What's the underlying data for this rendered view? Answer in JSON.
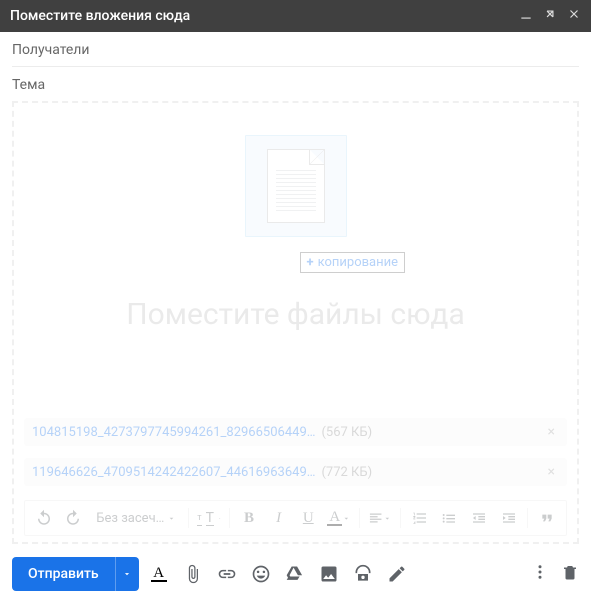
{
  "header": {
    "title": "Поместите вложения сюда"
  },
  "fields": {
    "recipients": {
      "label": "Получатели"
    },
    "subject": {
      "placeholder": "Тема"
    }
  },
  "dropzone": {
    "hint": "Поместите файлы сюда",
    "copyLabel": "копирование"
  },
  "attachments": [
    {
      "name": "104815198_4273797745994261_82966506449…",
      "size": "(567 КБ)"
    },
    {
      "name": "119646626_4709514242422607_44616963649…",
      "size": "(772 КБ)"
    }
  ],
  "format": {
    "fontFamily": "Без засеч…"
  },
  "actions": {
    "send": "Отправить"
  },
  "colors": {
    "accent": "#1a73e8",
    "titlebar": "#404040"
  }
}
